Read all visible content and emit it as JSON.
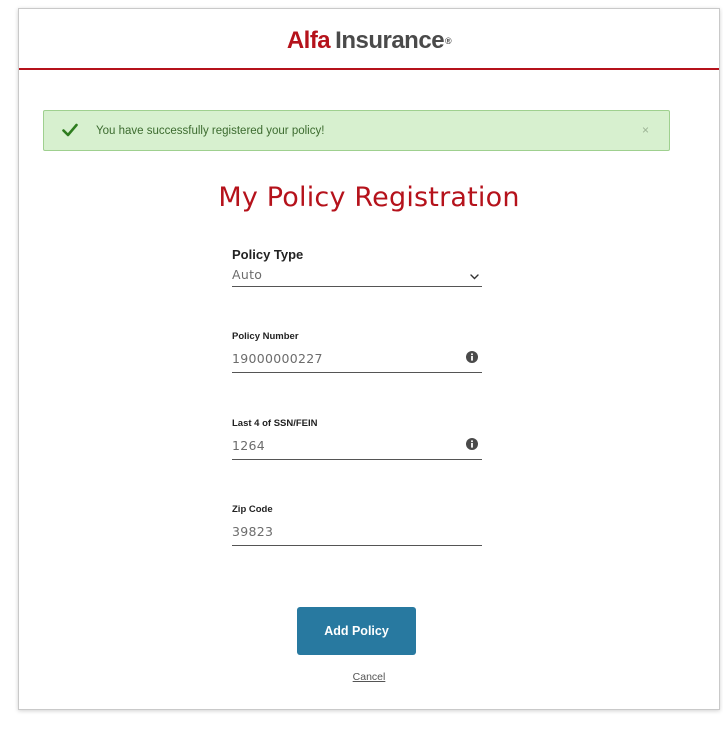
{
  "header": {
    "brand": "Alfa",
    "brand_word": "Insurance",
    "registered_mark": "®"
  },
  "alert": {
    "message": "You have successfully registered your policy!",
    "close_glyph": "×"
  },
  "page_title": "My Policy Registration",
  "form": {
    "policy_type": {
      "label": "Policy Type",
      "value": "Auto"
    },
    "policy_number": {
      "label": "Policy Number",
      "value": "19000000227"
    },
    "ssn_fein": {
      "label": "Last 4 of SSN/FEIN",
      "value": "1264"
    },
    "zip_code": {
      "label": "Zip Code",
      "value": "39823"
    }
  },
  "actions": {
    "add_policy_label": "Add Policy",
    "cancel_label": "Cancel"
  },
  "icons": {
    "success": "check-icon",
    "info": "info-icon",
    "dropdown": "chevron-down-icon",
    "close": "close-icon"
  },
  "colors": {
    "brand_red": "#b5121b",
    "alert_bg": "#d7f0cf",
    "alert_check": "#2e7d1f",
    "button_blue": "#2879a0"
  }
}
